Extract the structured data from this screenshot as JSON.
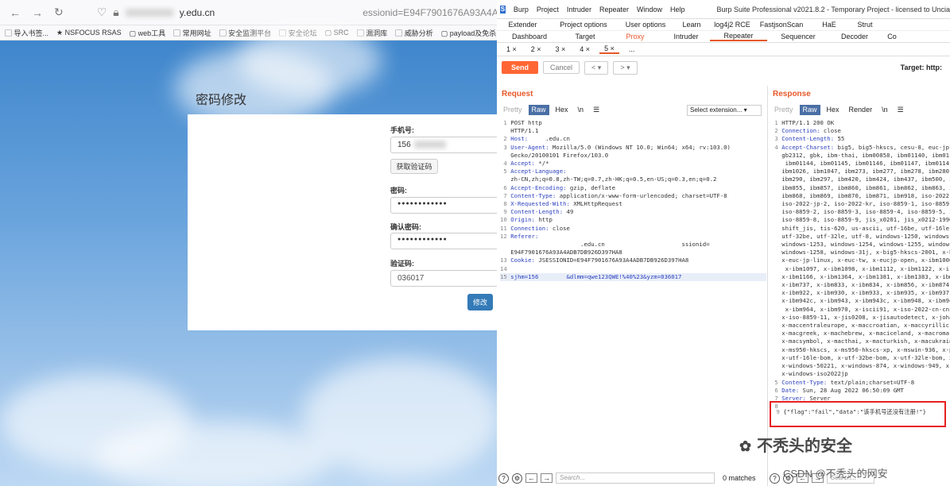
{
  "browser": {
    "url": "y.edu.cn",
    "url_tail": "essionid=E94F7901676A93A4ADB7D8926",
    "bookmarks": [
      "导入书签...",
      "NSFOCUS RSAS",
      "web工具",
      "常用网址",
      "安全监测平台",
      "安全论坛",
      "SRC",
      "漏洞库",
      "威胁分析",
      "payload及免杀"
    ]
  },
  "form": {
    "title": "密码修改",
    "phone_label": "手机号:",
    "phone_value": "156",
    "get_code_button": "获取验证码",
    "password_label": "密码:",
    "password_value": "●●●●●●●●●●●●",
    "confirm_label": "确认密码:",
    "confirm_value": "●●●●●●●●●●●●",
    "code_label": "验证码:",
    "code_value": "036017",
    "submit_button": "修改"
  },
  "burp": {
    "logo": "S",
    "menu": [
      "Burp",
      "Project",
      "Intruder",
      "Repeater",
      "Window",
      "Help"
    ],
    "title": "Burp Suite Professional v2021.8.2 - Temporary Project - licensed to Uncia",
    "tabs_row1": [
      "Extender",
      "Project options",
      "User options",
      "Learn",
      "log4j2 RCE",
      "FastjsonScan",
      "HaE",
      "Strut"
    ],
    "tabs_row2": [
      "Dashboard",
      "Target",
      "Proxy",
      "Intruder",
      "Repeater",
      "Sequencer",
      "Decoder",
      "Co"
    ],
    "subtabs": [
      "1 ×",
      "2 ×",
      "3 ×",
      "4 ×",
      "5 ×",
      "..."
    ],
    "send": "Send",
    "cancel": "Cancel",
    "target": "Target: http:",
    "request": {
      "heading": "Request",
      "tabs": [
        "Pretty",
        "Raw",
        "Hex",
        "\\n",
        "☰"
      ],
      "select_extension": "Select extension...",
      "lines": [
        {
          "n": "1",
          "k": "",
          "v": "POST http"
        },
        {
          "n": "",
          "k": "",
          "v": "HTTP/1.1"
        },
        {
          "n": "2",
          "k": "Host:",
          "v": "    .edu.cn"
        },
        {
          "n": "3",
          "k": "User-Agent:",
          "v": "Mozilla/5.0 (Windows NT 10.0; Win64; x64; rv:103.0)"
        },
        {
          "n": "",
          "k": "",
          "v": "Gecko/20100101 Firefox/103.0"
        },
        {
          "n": "4",
          "k": "Accept:",
          "v": "*/*"
        },
        {
          "n": "5",
          "k": "Accept-Language:",
          "v": ""
        },
        {
          "n": "",
          "k": "",
          "v": "zh-CN,zh;q=0.8,zh-TW;q=0.7,zh-HK;q=0.5,en-US;q=0.3,en;q=0.2"
        },
        {
          "n": "6",
          "k": "Accept-Encoding:",
          "v": "gzip, deflate"
        },
        {
          "n": "7",
          "k": "Content-Type:",
          "v": "application/x-www-form-urlencoded; charset=UTF-8"
        },
        {
          "n": "8",
          "k": "X-Requested-With:",
          "v": "XMLHttpRequest"
        },
        {
          "n": "9",
          "k": "Content-Length:",
          "v": "49"
        },
        {
          "n": "10",
          "k": "Origin:",
          "v": "http"
        },
        {
          "n": "11",
          "k": "Connection:",
          "v": "close"
        },
        {
          "n": "12",
          "k": "Referer:",
          "v": ""
        },
        {
          "n": "",
          "k": "",
          "v": "                    .edu.cn                      ssionid="
        },
        {
          "n": "",
          "k": "",
          "v": "E94F7901676A93A4ADB7DB926D397HA8"
        },
        {
          "n": "13",
          "k": "Cookie:",
          "v": "JSESSIONID=E94F7901676A93A4ADB7DB926D397HA8"
        },
        {
          "n": "14",
          "k": "",
          "v": ""
        },
        {
          "n": "15",
          "k": "",
          "v": "sjhm=156        &dlmm=qwe123QWE!%40%23&yzm=036017"
        }
      ]
    },
    "response": {
      "heading": "Response",
      "tabs": [
        "Pretty",
        "Raw",
        "Hex",
        "Render",
        "\\n",
        "☰"
      ],
      "lines": [
        {
          "n": "1",
          "k": "",
          "v": "HTTP/1.1 200 OK"
        },
        {
          "n": "2",
          "k": "Connection:",
          "v": "close"
        },
        {
          "n": "3",
          "k": "Content-Length:",
          "v": "55"
        },
        {
          "n": "4",
          "k": "Accept-Charset:",
          "v": "big5, big5-hkscs, cesu-8, euc-jp,"
        },
        {
          "n": "",
          "k": "",
          "v": "gb2312, gbk, ibm-thai, ibm00858, ibm01140, ibm0114"
        },
        {
          "n": "",
          "k": "",
          "v": " ibm01144, ibm01145, ibm01146, ibm01147, ibm0114"
        },
        {
          "n": "",
          "k": "",
          "v": "ibm1026, ibm1047, ibm273, ibm277, ibm278, ibm280,"
        },
        {
          "n": "",
          "k": "",
          "v": "ibm290, ibm297, ibm420, ibm424, ibm437, ibm500, i"
        },
        {
          "n": "",
          "k": "",
          "v": "ibm855, ibm857, ibm860, ibm861, ibm862, ibm863, i"
        },
        {
          "n": "",
          "k": "",
          "v": "ibm868, ibm869, ibm870, ibm871, ibm918, iso-2022-"
        },
        {
          "n": "",
          "k": "",
          "v": "iso-2022-jp-2, iso-2022-kr, iso-8859-1, iso-8859-"
        },
        {
          "n": "",
          "k": "",
          "v": "iso-8859-2, iso-8859-3, iso-8859-4, iso-8859-5, i"
        },
        {
          "n": "",
          "k": "",
          "v": "iso-8859-8, iso-8859-9, jis_x0201, jis_x0212-1990"
        },
        {
          "n": "",
          "k": "",
          "v": "shift_jis, tis-620, us-ascii, utf-16be, utf-16le,"
        },
        {
          "n": "",
          "k": "",
          "v": "utf-32be, utf-32le, utf-8, windows-1250, windows-"
        },
        {
          "n": "",
          "k": "",
          "v": "windows-1253, windows-1254, windows-1255, windows-"
        },
        {
          "n": "",
          "k": "",
          "v": "windows-1258, windows-31j, x-big5-hkscs-2001, x-b"
        },
        {
          "n": "",
          "k": "",
          "v": "x-euc-jp-linux, x-euc-tw, x-eucjp-open, x-ibm1006"
        },
        {
          "n": "",
          "k": "",
          "v": " x-ibm1097, x-ibm1098, x-ibm1112, x-ibm1122, x-i"
        },
        {
          "n": "",
          "k": "",
          "v": "x-ibm1166, x-ibm1364, x-ibm1381, x-ibm1383, x-ibm"
        },
        {
          "n": "",
          "k": "",
          "v": "x-ibm737, x-ibm833, x-ibm834, x-ibm856, x-ibm874,"
        },
        {
          "n": "",
          "k": "",
          "v": "x-ibm922, x-ibm930, x-ibm933, x-ibm935, x-ibm937,"
        },
        {
          "n": "",
          "k": "",
          "v": "x-ibm942c, x-ibm943, x-ibm943c, x-ibm948, x-ibm94"
        },
        {
          "n": "",
          "k": "",
          "v": " x-ibm964, x-ibm970, x-iscii91, x-iso-2022-cn-cns"
        },
        {
          "n": "",
          "k": "",
          "v": "x-iso-8859-11, x-jis0208, x-jisautodetect, x-joha"
        },
        {
          "n": "",
          "k": "",
          "v": "x-maccentraleurope, x-maccroatian, x-maccyrillic,"
        },
        {
          "n": "",
          "k": "",
          "v": "x-macgreek, x-machebrew, x-maciceland, x-macroma"
        },
        {
          "n": "",
          "k": "",
          "v": "x-macsymbol, x-macthai, x-macturkish, x-macukrain"
        },
        {
          "n": "",
          "k": "",
          "v": "x-ms950-hkscs, x-ms950-hkscs-xp, x-mswin-936, x-p"
        },
        {
          "n": "",
          "k": "",
          "v": "x-utf-16le-bom, x-utf-32be-bom, x-utf-32le-bom, x"
        },
        {
          "n": "",
          "k": "",
          "v": "x-windows-50221, x-windows-874, x-windows-949, x-"
        },
        {
          "n": "",
          "k": "",
          "v": "x-windows-iso2022jp"
        },
        {
          "n": "5",
          "k": "Content-Type:",
          "v": "text/plain;charset=UTF-8"
        },
        {
          "n": "6",
          "k": "Date:",
          "v": "Sun, 28 Aug 2022 06:50:09 GMT"
        },
        {
          "n": "7",
          "k": "Server:",
          "v": "Server"
        },
        {
          "n": "8",
          "k": "",
          "v": ""
        },
        {
          "n": "9",
          "k": "",
          "v": "{\"flag\":\"fail\",\"data\":\"该手机号还没有注册!\"}"
        }
      ]
    },
    "footer_search": "Search...",
    "matches": "0 matches"
  },
  "watermark": "不秃头的安全",
  "csdn": "CSDN @不秃头的网安",
  "colors": {
    "accent": "#ff6633",
    "link": "#2f6fd0",
    "highlight": "#e62020"
  }
}
